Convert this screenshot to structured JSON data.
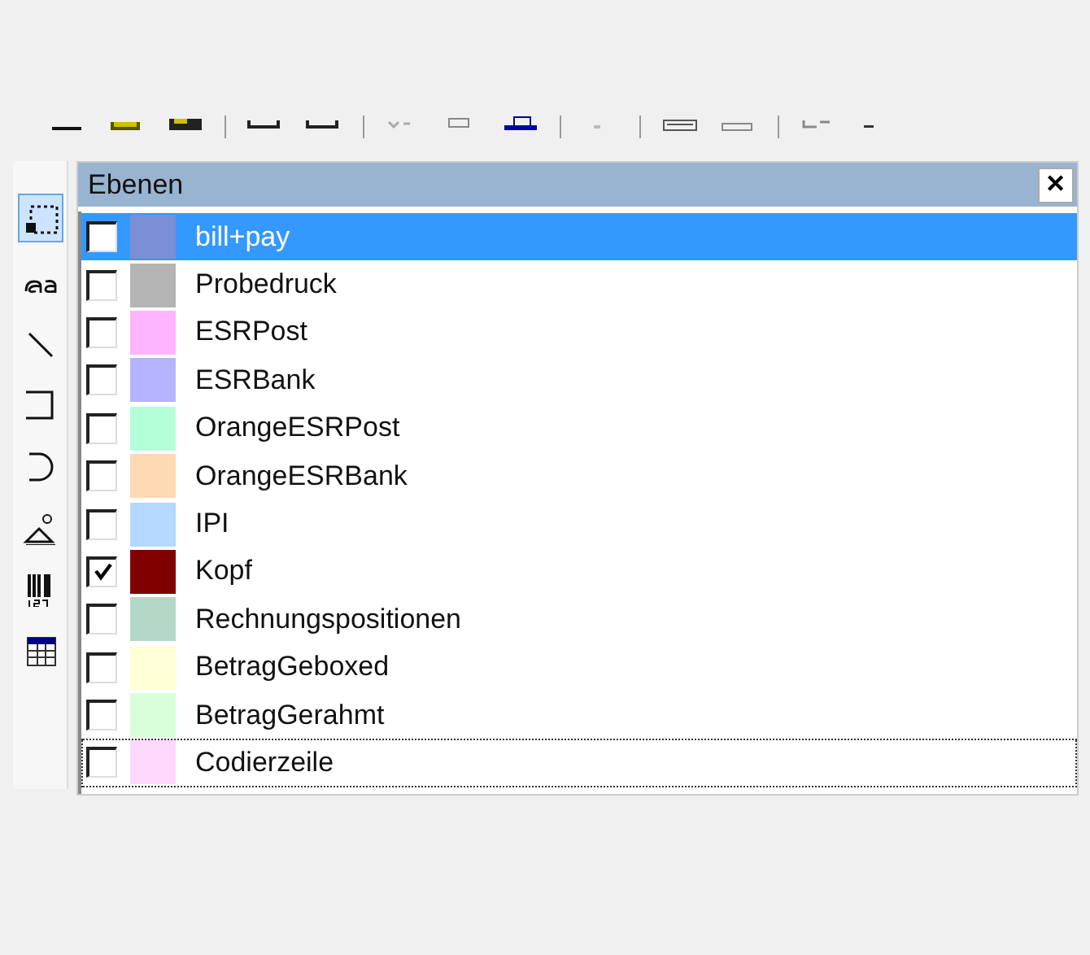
{
  "tools": [
    {
      "kind": "select",
      "selected": true
    },
    {
      "kind": "text",
      "selected": false
    },
    {
      "kind": "line",
      "selected": false
    },
    {
      "kind": "rect",
      "selected": false
    },
    {
      "kind": "ellipse",
      "selected": false
    },
    {
      "kind": "shape",
      "selected": false
    },
    {
      "kind": "barcode",
      "selected": false
    },
    {
      "kind": "table",
      "selected": false
    }
  ],
  "panel": {
    "title": "Ebenen",
    "close": "✕",
    "layers": [
      {
        "name": "bill+pay",
        "color": "#7b8fd6",
        "checked": false,
        "selected": true,
        "focused": false
      },
      {
        "name": "Probedruck",
        "color": "#b4b4b4",
        "checked": false,
        "selected": false,
        "focused": false
      },
      {
        "name": "ESRPost",
        "color": "#ffb4ff",
        "checked": false,
        "selected": false,
        "focused": false
      },
      {
        "name": "ESRBank",
        "color": "#b4b4ff",
        "checked": false,
        "selected": false,
        "focused": false
      },
      {
        "name": "OrangeESRPost",
        "color": "#b4ffd8",
        "checked": false,
        "selected": false,
        "focused": false
      },
      {
        "name": "OrangeESRBank",
        "color": "#ffd8b4",
        "checked": false,
        "selected": false,
        "focused": false
      },
      {
        "name": "IPI",
        "color": "#b4d8ff",
        "checked": false,
        "selected": false,
        "focused": false
      },
      {
        "name": "Kopf",
        "color": "#800000",
        "checked": true,
        "selected": false,
        "focused": false
      },
      {
        "name": "Rechnungspositionen",
        "color": "#b4d8c8",
        "checked": false,
        "selected": false,
        "focused": false
      },
      {
        "name": "BetragGeboxed",
        "color": "#ffffd8",
        "checked": false,
        "selected": false,
        "focused": false
      },
      {
        "name": "BetragGerahmt",
        "color": "#d8ffd8",
        "checked": false,
        "selected": false,
        "focused": false
      },
      {
        "name": "Codierzeile",
        "color": "#ffd8ff",
        "checked": false,
        "selected": false,
        "focused": true
      }
    ]
  }
}
